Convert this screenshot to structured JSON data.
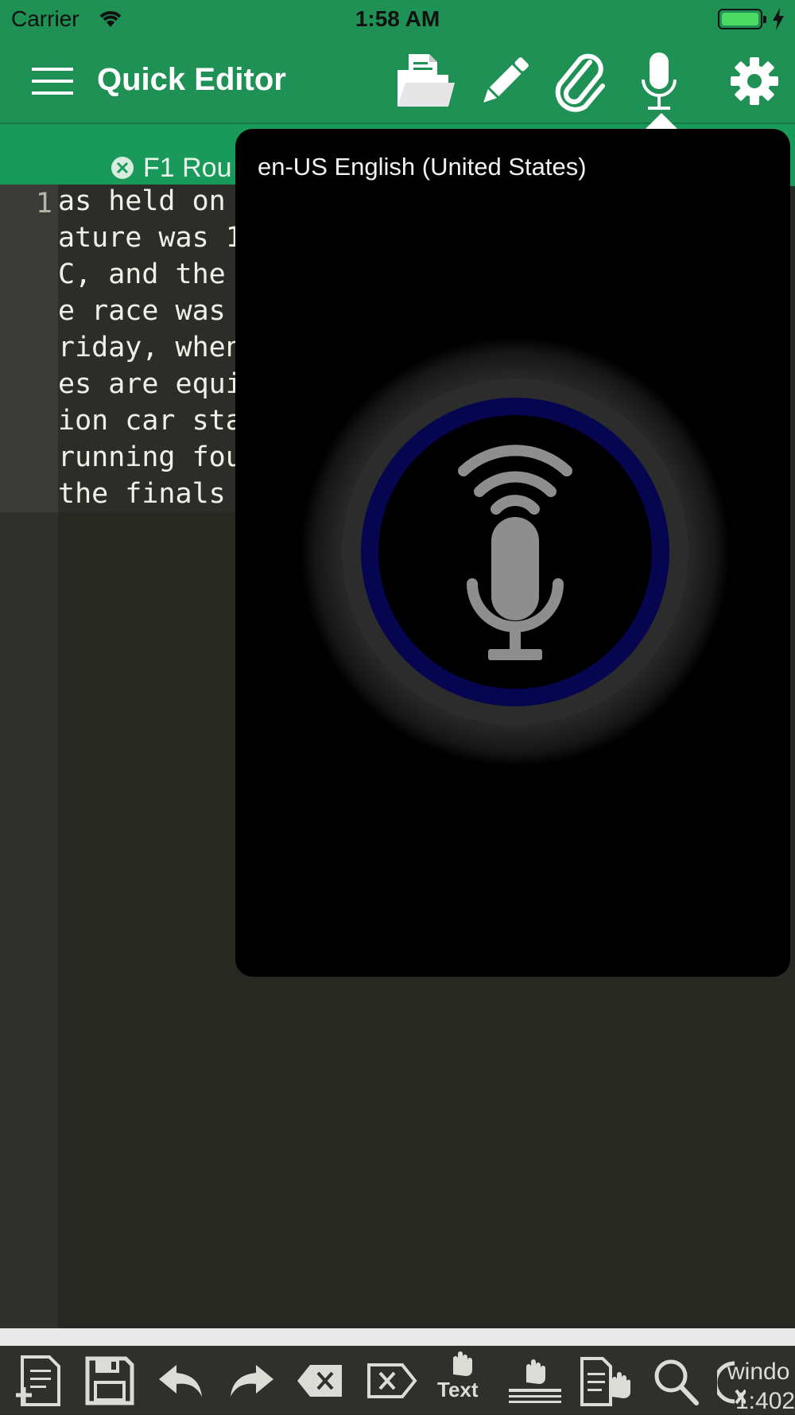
{
  "status": {
    "carrier": "Carrier",
    "time": "1:58 AM"
  },
  "app": {
    "title": "Quick Editor"
  },
  "tab": {
    "title": "F1 Rou"
  },
  "editor": {
    "line_number": "1",
    "lines": [
      "as held on",
      "ature was 1",
      "C, and the",
      "e race was",
      "riday, when",
      "es are equi",
      "ion car sta",
      "running fou",
      "the finals"
    ]
  },
  "voice": {
    "language": "en-US English (United States)"
  },
  "toolbar": {
    "text_label": "Text",
    "window_label": "windo",
    "window_sub": "1:402"
  },
  "colors": {
    "header": "#1f9155",
    "editor_bg": "#272822",
    "popover_bg": "#000000",
    "mic_ring": "#050550"
  }
}
